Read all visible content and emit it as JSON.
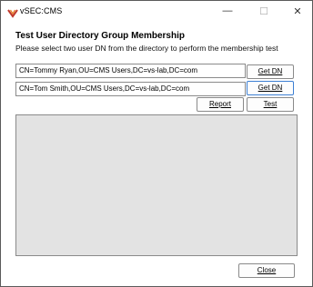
{
  "window": {
    "title": "vSEC:CMS",
    "icon": "vsec-logo-icon",
    "controls": {
      "minimize": "—",
      "maximize": "☐",
      "close": "✕"
    }
  },
  "dialog": {
    "heading": "Test User Directory Group Membership",
    "subheading": "Please select two user DN from the directory to perform the membership test"
  },
  "fields": {
    "dn1": "CN=Tommy Ryan,OU=CMS Users,DC=vs-lab,DC=com",
    "dn2": "CN=Tom Smith,OU=CMS Users,DC=vs-lab,DC=com"
  },
  "buttons": {
    "get_dn_1": "Get DN",
    "get_dn_2": "Get DN",
    "report": "Report",
    "test": "Test",
    "close": "Close"
  },
  "results": {
    "content": ""
  }
}
